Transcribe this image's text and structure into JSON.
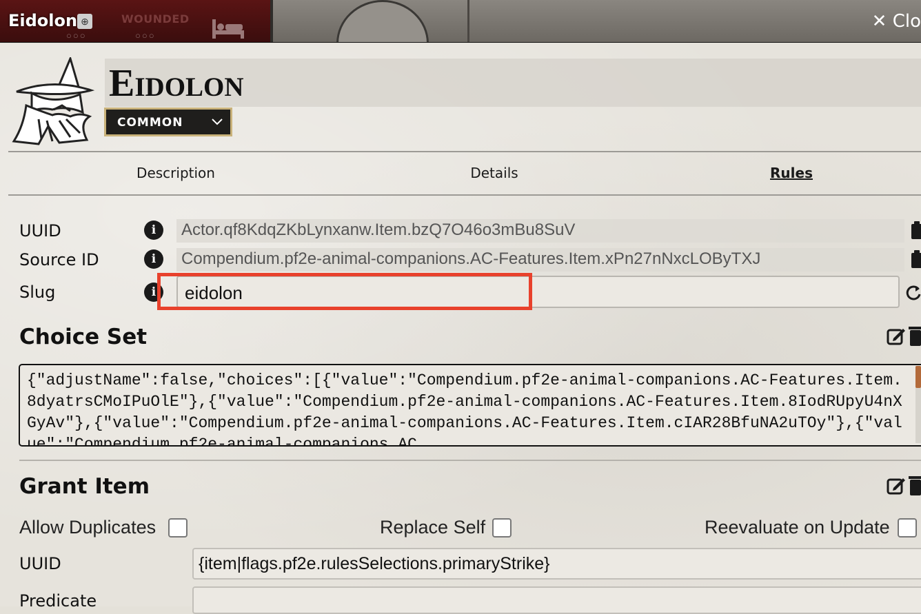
{
  "window": {
    "title": "Eidolon",
    "wounded_label": "WOUNDED",
    "close_label": "✕ Clo"
  },
  "item": {
    "name": "Eidolon",
    "rarity": "COMMON"
  },
  "tabs": [
    "Description",
    "Details",
    "Rules"
  ],
  "active_tab": "Rules",
  "fields": {
    "uuid_label": "UUID",
    "uuid_value": "Actor.qf8KdqZKbLynxanw.Item.bzQ7O46o3mBu8SuV",
    "source_label": "Source ID",
    "source_value": "Compendium.pf2e-animal-companions.AC-Features.Item.xPn27nNxcLOByTXJ",
    "slug_label": "Slug",
    "slug_value": "eidolon"
  },
  "choice_set": {
    "title": "Choice Set",
    "json": "{\"adjustName\":false,\"choices\":[{\"value\":\"Compendium.pf2e-animal-companions.AC-Features.Item.8dyatrsCMoIPuOlE\"},{\"value\":\"Compendium.pf2e-animal-companions.AC-Features.Item.8IodRUpyU4nXGyAv\"},{\"value\":\"Compendium.pf2e-animal-companions.AC-Features.Item.cIAR28BfuNA2uTOy\"},{\"value\":\"Compendium.pf2e-animal-companions.AC"
  },
  "grant_item": {
    "title": "Grant Item",
    "allow_duplicates_label": "Allow Duplicates",
    "replace_self_label": "Replace Self",
    "reevaluate_label": "Reevaluate on Update",
    "uuid_label": "UUID",
    "uuid_value": "{item|flags.pf2e.rulesSelections.primaryStrike}",
    "predicate_label": "Predicate",
    "predicate_value": ""
  },
  "colors": {
    "highlight": "#e8412c",
    "rarity_border": "#c9b27a",
    "header_bg": "#2f2d2a"
  },
  "icons": [
    "globe-icon",
    "bed-icon",
    "close-icon",
    "wizard-logo-icon",
    "chevron-down-icon",
    "info-icon",
    "clipboard-icon",
    "refresh-icon",
    "edit-icon",
    "trash-icon"
  ]
}
